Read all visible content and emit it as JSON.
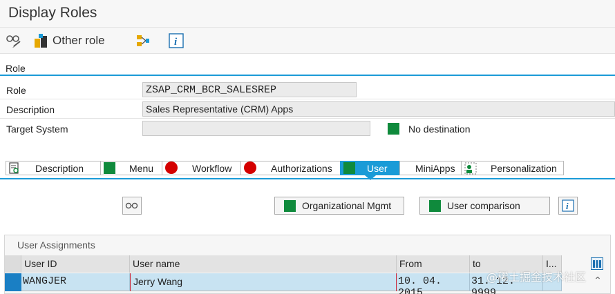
{
  "window": {
    "title": "Display Roles"
  },
  "toolbar": {
    "other_role_label": "Other role"
  },
  "section": {
    "label": "Role"
  },
  "form": {
    "role_label": "Role",
    "role_value": "ZSAP_CRM_BCR_SALESREP",
    "description_label": "Description",
    "description_value": "Sales Representative (CRM) Apps",
    "target_system_label": "Target System",
    "target_system_value": "",
    "destination_status": "No destination"
  },
  "tabs": [
    {
      "label": "Description",
      "icon": "description-icon"
    },
    {
      "label": "Menu",
      "icon": "green-status-icon"
    },
    {
      "label": "Workflow",
      "icon": "red-status-icon"
    },
    {
      "label": "Authorizations",
      "icon": "red-status-icon"
    },
    {
      "label": "User",
      "icon": "green-status-icon",
      "active": true
    },
    {
      "label": "MiniApps",
      "icon": ""
    },
    {
      "label": "Personalization",
      "icon": "personalization-icon"
    }
  ],
  "actions": {
    "org_mgmt_label": "Organizational Mgmt",
    "user_comparison_label": "User comparison"
  },
  "user_assignments": {
    "title": "User Assignments",
    "columns": [
      "User ID",
      "User name",
      "From",
      "to",
      "I..."
    ],
    "rows": [
      {
        "user_id": "WANGJER",
        "user_name": "Jerry Wang",
        "from": "10. 04. 2015",
        "to": "31. 12. 9999"
      }
    ]
  },
  "watermark": "@稀土掘金技术社区",
  "colors": {
    "accent": "#1a9bd7",
    "green": "#0f8a3c",
    "red": "#d40000",
    "row_selected": "#c8e3f2"
  }
}
